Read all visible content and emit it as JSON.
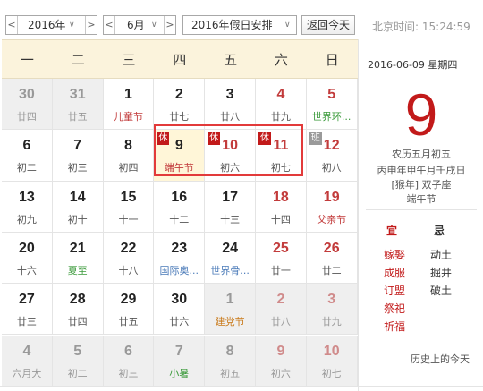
{
  "toolbar": {
    "year": "2016年",
    "month": "6月",
    "holiday_select": "2016年假日安排",
    "today_button": "返回今天",
    "clock_label": "北京时间:",
    "clock_time": "15:24:59",
    "prev": "<",
    "next": ">",
    "dropdown": "∨"
  },
  "weekdays": [
    "一",
    "二",
    "三",
    "四",
    "五",
    "六",
    "日"
  ],
  "tags": {
    "rest": "休",
    "work": "班"
  },
  "days": [
    {
      "d": "30",
      "s": "廿四",
      "other": true
    },
    {
      "d": "31",
      "s": "廿五",
      "other": true
    },
    {
      "d": "1",
      "s": "儿童节",
      "sc": "red"
    },
    {
      "d": "2",
      "s": "廿七"
    },
    {
      "d": "3",
      "s": "廿八"
    },
    {
      "d": "4",
      "s": "廿九",
      "we": true
    },
    {
      "d": "5",
      "s": "世界环...",
      "sc": "green",
      "we": true
    },
    {
      "d": "6",
      "s": "初二"
    },
    {
      "d": "7",
      "s": "初三"
    },
    {
      "d": "8",
      "s": "初四"
    },
    {
      "d": "9",
      "s": "端午节",
      "sc": "red",
      "tag": "rest",
      "today": true,
      "hol": true
    },
    {
      "d": "10",
      "s": "初六",
      "tag": "rest",
      "we": true,
      "hol": true
    },
    {
      "d": "11",
      "s": "初七",
      "tag": "rest",
      "we": true,
      "hol": true
    },
    {
      "d": "12",
      "s": "初八",
      "tag": "work",
      "we": true
    },
    {
      "d": "13",
      "s": "初九"
    },
    {
      "d": "14",
      "s": "初十"
    },
    {
      "d": "15",
      "s": "十一"
    },
    {
      "d": "16",
      "s": "十二"
    },
    {
      "d": "17",
      "s": "十三"
    },
    {
      "d": "18",
      "s": "十四",
      "we": true
    },
    {
      "d": "19",
      "s": "父亲节",
      "sc": "red",
      "we": true
    },
    {
      "d": "20",
      "s": "十六"
    },
    {
      "d": "21",
      "s": "夏至",
      "sc": "green"
    },
    {
      "d": "22",
      "s": "十八"
    },
    {
      "d": "23",
      "s": "国际奥...",
      "sc": "blue"
    },
    {
      "d": "24",
      "s": "世界骨...",
      "sc": "blue"
    },
    {
      "d": "25",
      "s": "廿一",
      "we": true
    },
    {
      "d": "26",
      "s": "廿二",
      "we": true
    },
    {
      "d": "27",
      "s": "廿三"
    },
    {
      "d": "28",
      "s": "廿四"
    },
    {
      "d": "29",
      "s": "廿五"
    },
    {
      "d": "30",
      "s": "廿六"
    },
    {
      "d": "1",
      "s": "建党节",
      "sc": "orange",
      "other": true
    },
    {
      "d": "2",
      "s": "廿八",
      "other": true,
      "we": true
    },
    {
      "d": "3",
      "s": "廿九",
      "other": true,
      "we": true
    },
    {
      "d": "4",
      "s": "六月大",
      "other": true
    },
    {
      "d": "5",
      "s": "初二",
      "other": true
    },
    {
      "d": "6",
      "s": "初三",
      "other": true
    },
    {
      "d": "7",
      "s": "小暑",
      "sc": "green",
      "other": true
    },
    {
      "d": "8",
      "s": "初五",
      "other": true
    },
    {
      "d": "9",
      "s": "初六",
      "other": true,
      "we": true
    },
    {
      "d": "10",
      "s": "初七",
      "other": true,
      "we": true
    }
  ],
  "side": {
    "date": "2016-06-09",
    "weekday": "星期四",
    "big_day": "9",
    "lunar": "农历五月初五",
    "ganzhi": "丙申年甲午月壬戌日",
    "zodiac": "[猴年] 双子座",
    "festival": "端午节",
    "yi_label": "宜",
    "ji_label": "忌",
    "yi": [
      "嫁娶",
      "成服",
      "订盟",
      "祭祀",
      "祈福"
    ],
    "ji": [
      "动土",
      "掘井",
      "破土"
    ],
    "history": "历史上的今天"
  }
}
